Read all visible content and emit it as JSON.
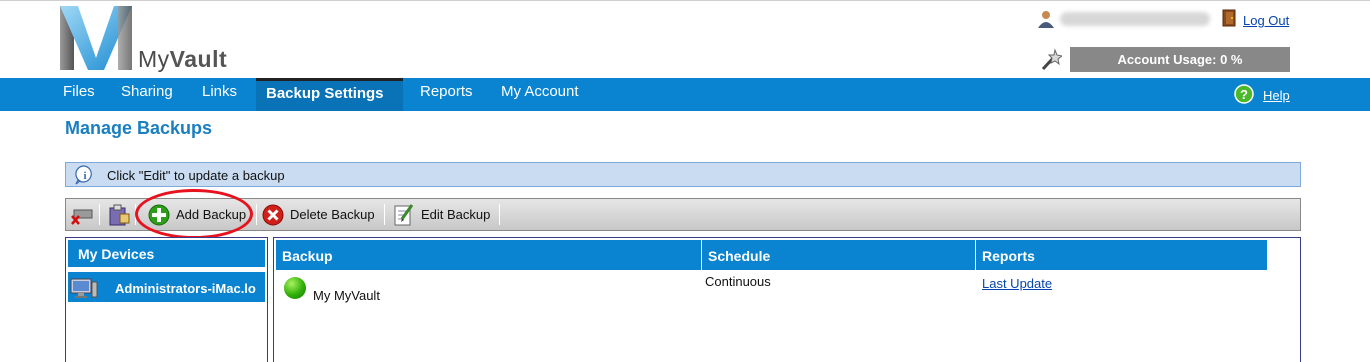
{
  "brand": {
    "name_prefix": "My",
    "name_suffix": "Vault"
  },
  "user": {
    "logout_label": "Log Out",
    "account_usage": "Account Usage: 0 %"
  },
  "nav": {
    "items": [
      {
        "label": "Files",
        "active": false
      },
      {
        "label": "Sharing",
        "active": false
      },
      {
        "label": "Links",
        "active": false
      },
      {
        "label": "Backup Settings",
        "active": true
      },
      {
        "label": "Reports",
        "active": false
      },
      {
        "label": "My Account",
        "active": false
      }
    ],
    "help_label": "Help"
  },
  "page": {
    "title": "Manage Backups",
    "info_message": "Click \"Edit\" to update a backup"
  },
  "toolbar": {
    "add_label": "Add Backup",
    "delete_label": "Delete Backup",
    "edit_label": "Edit Backup",
    "highlight_color": "#e8121e"
  },
  "devices": {
    "header": "My Devices",
    "items": [
      {
        "label": "Administrators-iMac.lo",
        "selected": true
      }
    ]
  },
  "backups": {
    "columns": [
      "Backup",
      "Schedule",
      "Reports"
    ],
    "rows": [
      {
        "status": "active",
        "name": "My MyVault",
        "schedule": "Continuous",
        "report_link": "Last Update"
      }
    ]
  },
  "colors": {
    "nav_blue": "#0a84d0",
    "title_blue": "#1a7fc1",
    "info_bg": "#c9dcf1"
  },
  "icons": [
    "user-icon",
    "logout-door-icon",
    "usage-wand-icon",
    "help-icon",
    "info-icon",
    "remove-device-icon",
    "clipboard-icon",
    "add-icon",
    "delete-icon",
    "edit-icon",
    "computer-icon",
    "status-green-icon"
  ]
}
